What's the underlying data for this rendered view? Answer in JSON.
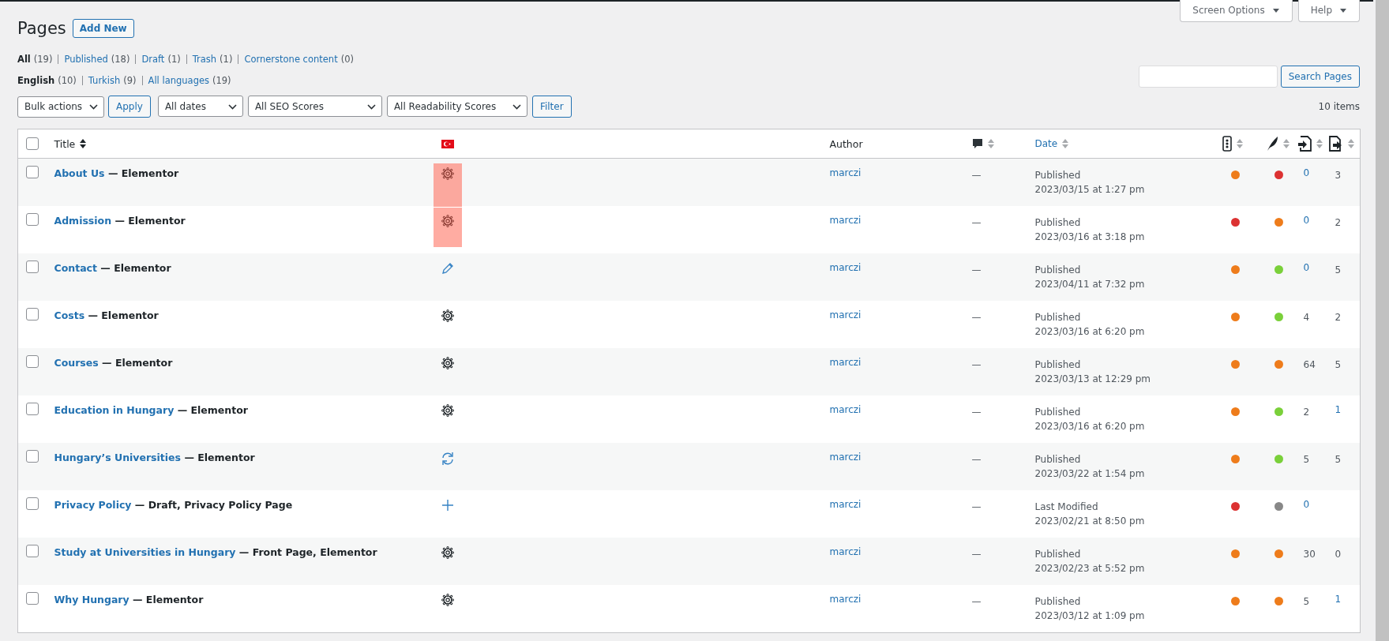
{
  "screen_meta": [
    {
      "label": "Screen Options"
    },
    {
      "label": "Help"
    }
  ],
  "heading": {
    "title": "Pages",
    "add_new": "Add New"
  },
  "status_filters": [
    {
      "label": "All",
      "count": "(19)",
      "selected": true
    },
    {
      "label": "Published",
      "count": "(18)",
      "selected": false
    },
    {
      "label": "Draft",
      "count": "(1)",
      "selected": false
    },
    {
      "label": "Trash",
      "count": "(1)",
      "selected": false
    },
    {
      "label": "Cornerstone content",
      "count": "(0)",
      "selected": false
    }
  ],
  "language_filters": [
    {
      "label": "English",
      "count": "(10)",
      "selected": true
    },
    {
      "label": "Turkish",
      "count": "(9)",
      "selected": false
    },
    {
      "label": "All languages",
      "count": "(19)",
      "selected": false
    }
  ],
  "search": {
    "button": "Search Pages"
  },
  "bulk_actions": {
    "select": "Bulk actions",
    "apply": "Apply"
  },
  "filters": {
    "selects": [
      "All dates",
      "All SEO Scores",
      "All Readability Scores"
    ],
    "button": "Filter"
  },
  "item_count": "10 items",
  "table": {
    "select_all": {
      "checked": false
    },
    "columns": [
      {
        "kind": "title",
        "label": "Title",
        "sortable": true,
        "sorted": true
      },
      {
        "kind": "flag",
        "sortable": false,
        "sorted": false
      },
      {
        "kind": "author",
        "label": "Author",
        "sortable": false,
        "sorted": false
      },
      {
        "kind": "comments",
        "sortable": true,
        "sorted": false
      },
      {
        "kind": "date",
        "label": "Date",
        "sortable": true,
        "sorted": false
      },
      {
        "kind": "seo",
        "sortable": true,
        "sorted": false
      },
      {
        "kind": "readability",
        "sortable": true,
        "sorted": false
      },
      {
        "kind": "links",
        "sortable": true,
        "sorted": false
      },
      {
        "kind": "linked",
        "sortable": true,
        "sorted": false
      }
    ],
    "rows": [
      {
        "checked": false,
        "title": "About Us",
        "states": " — Elementor",
        "language": {
          "kind": "gear"
        },
        "highlighted": true,
        "author": "marczi",
        "comments": "—",
        "status": "Published",
        "date": "2023/03/15 at 1:27 pm",
        "seo": {
          "color": "#ee7c1b"
        },
        "readability": {
          "color": "#dc3232"
        },
        "links": {
          "text": "0",
          "link": true
        },
        "linked": {
          "text": "3",
          "link": false
        }
      },
      {
        "checked": false,
        "title": "Admission",
        "states": " — Elementor",
        "language": {
          "kind": "gear"
        },
        "highlighted": true,
        "author": "marczi",
        "comments": "—",
        "status": "Published",
        "date": "2023/03/16 at 3:18 pm",
        "seo": {
          "color": "#dc3232"
        },
        "readability": {
          "color": "#ee7c1b"
        },
        "links": {
          "text": "0",
          "link": true
        },
        "linked": {
          "text": "2",
          "link": false
        }
      },
      {
        "checked": false,
        "title": "Contact",
        "states": " — Elementor",
        "language": {
          "kind": "pencil"
        },
        "highlighted": false,
        "author": "marczi",
        "comments": "—",
        "status": "Published",
        "date": "2023/04/11 at 7:32 pm",
        "seo": {
          "color": "#ee7c1b"
        },
        "readability": {
          "color": "#7ad03a"
        },
        "links": {
          "text": "0",
          "link": true
        },
        "linked": {
          "text": "5",
          "link": false
        }
      },
      {
        "checked": false,
        "title": "Costs",
        "states": " — Elementor",
        "language": {
          "kind": "gear"
        },
        "highlighted": false,
        "author": "marczi",
        "comments": "—",
        "status": "Published",
        "date": "2023/03/16 at 6:20 pm",
        "seo": {
          "color": "#ee7c1b"
        },
        "readability": {
          "color": "#7ad03a"
        },
        "links": {
          "text": "4",
          "link": false
        },
        "linked": {
          "text": "2",
          "link": false
        }
      },
      {
        "checked": false,
        "title": "Courses",
        "states": " — Elementor",
        "language": {
          "kind": "gear"
        },
        "highlighted": false,
        "author": "marczi",
        "comments": "—",
        "status": "Published",
        "date": "2023/03/13 at 12:29 pm",
        "seo": {
          "color": "#ee7c1b"
        },
        "readability": {
          "color": "#ee7c1b"
        },
        "links": {
          "text": "64",
          "link": false
        },
        "linked": {
          "text": "5",
          "link": false
        }
      },
      {
        "checked": false,
        "title": "Education in Hungary",
        "states": " — Elementor",
        "language": {
          "kind": "gear"
        },
        "highlighted": false,
        "author": "marczi",
        "comments": "—",
        "status": "Published",
        "date": "2023/03/16 at 6:20 pm",
        "seo": {
          "color": "#ee7c1b"
        },
        "readability": {
          "color": "#7ad03a"
        },
        "links": {
          "text": "2",
          "link": false
        },
        "linked": {
          "text": "1",
          "link": true
        }
      },
      {
        "checked": false,
        "title": "Hungary’s Universities",
        "states": " — Elementor",
        "language": {
          "kind": "sync"
        },
        "highlighted": false,
        "author": "marczi",
        "comments": "—",
        "status": "Published",
        "date": "2023/03/22 at 1:54 pm",
        "seo": {
          "color": "#ee7c1b"
        },
        "readability": {
          "color": "#7ad03a"
        },
        "links": {
          "text": "5",
          "link": false
        },
        "linked": {
          "text": "5",
          "link": false
        }
      },
      {
        "checked": false,
        "title": "Privacy Policy",
        "states": " — Draft, Privacy Policy Page",
        "language": {
          "kind": "plus"
        },
        "highlighted": false,
        "author": "marczi",
        "comments": "—",
        "status": "Last Modified",
        "date": "2023/02/21 at 8:50 pm",
        "seo": {
          "color": "#dc3232"
        },
        "readability": {
          "color": "#888888"
        },
        "links": {
          "text": "0",
          "link": true
        }
      },
      {
        "checked": false,
        "title": "Study at Universities in Hungary",
        "states": " — Front Page, Elementor",
        "language": {
          "kind": "gear"
        },
        "highlighted": false,
        "author": "marczi",
        "comments": "—",
        "status": "Published",
        "date": "2023/02/23 at 5:52 pm",
        "seo": {
          "color": "#ee7c1b"
        },
        "readability": {
          "color": "#ee7c1b"
        },
        "links": {
          "text": "30",
          "link": false
        },
        "linked": {
          "text": "0",
          "link": false
        }
      },
      {
        "checked": false,
        "title": "Why Hungary",
        "states": " — Elementor",
        "language": {
          "kind": "gear"
        },
        "highlighted": false,
        "author": "marczi",
        "comments": "—",
        "status": "Published",
        "date": "2023/03/12 at 1:09 pm",
        "seo": {
          "color": "#ee7c1b"
        },
        "readability": {
          "color": "#ee7c1b"
        },
        "links": {
          "text": "5",
          "link": false
        },
        "linked": {
          "text": "1",
          "link": true
        }
      }
    ]
  }
}
